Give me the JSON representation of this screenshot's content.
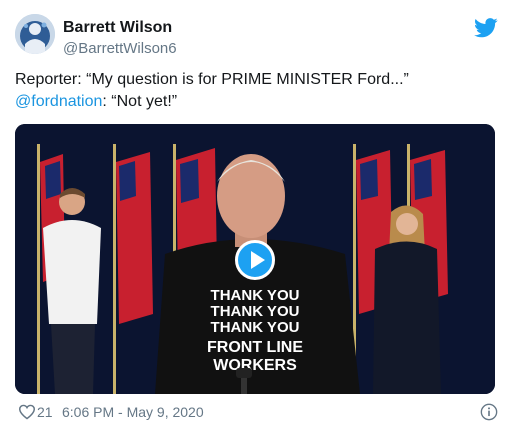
{
  "author": {
    "display_name": "Barrett Wilson",
    "handle": "@BarrettWilson6",
    "avatar_icon": "avatar-image"
  },
  "tweet": {
    "line1": "Reporter: “My question is for PRIME MINISTER Ford...”",
    "mention": "@fordnation",
    "line2_rest": ": “Not yet!”"
  },
  "media": {
    "kind": "video",
    "play_icon": "play-icon",
    "shirt_lines": [
      "THANK YOU",
      "THANK YOU",
      "THANK YOU",
      "FRONT LINE",
      "WORKERS"
    ]
  },
  "footer": {
    "likes": "21",
    "timestamp": "6:06 PM - May 9, 2020"
  },
  "colors": {
    "brand": "#1da1f2",
    "link": "#1b95e0",
    "muted": "#657786",
    "text": "#14171a"
  }
}
